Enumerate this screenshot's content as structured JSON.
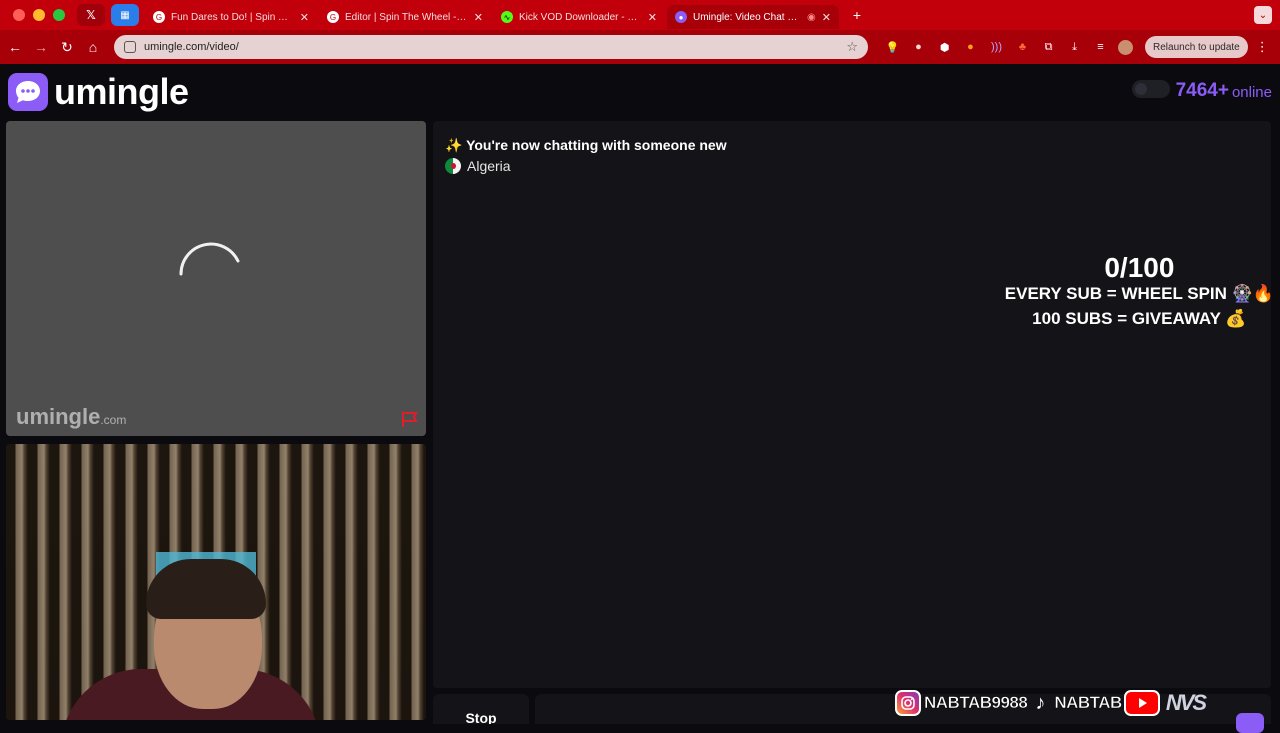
{
  "browser": {
    "tabs": [
      {
        "title": "",
        "icon": "x-logo-icon",
        "pinned": true
      },
      {
        "title": "",
        "icon": "app-icon",
        "pinned": true
      },
      {
        "title": "Fun Dares to Do! | Spin The W",
        "icon": "google-icon"
      },
      {
        "title": "Editor | Spin The Wheel - Ran",
        "icon": "google-icon"
      },
      {
        "title": "Kick VOD Downloader - Strea",
        "icon": "kick-icon"
      },
      {
        "title": "Umingle: Video Chat with",
        "icon": "umingle-icon",
        "active": true
      }
    ],
    "url": "umingle.com/video/",
    "relaunch_label": "Relaunch to update"
  },
  "header": {
    "brand": "umingle",
    "online_count": "7464+",
    "online_label": "online"
  },
  "stranger_pane": {
    "watermark": "umingle",
    "watermark_suffix": ".com"
  },
  "chat": {
    "status_message": "✨ You're now chatting with someone new",
    "country": "Algeria"
  },
  "stream_overlay": {
    "sub_count": "0/100",
    "line1": "EVERY SUB = WHEEL SPIN 🎡🔥",
    "line2": "100 SUBS = GIVEAWAY 💰"
  },
  "controls": {
    "stop_label": "Stop"
  },
  "socials": {
    "instagram": "NABTAB9988",
    "tiktok": "NABTAB",
    "logo": "NVS"
  },
  "colors": {
    "accent": "#8b5cf6",
    "browser_chrome": "#c2000b"
  }
}
